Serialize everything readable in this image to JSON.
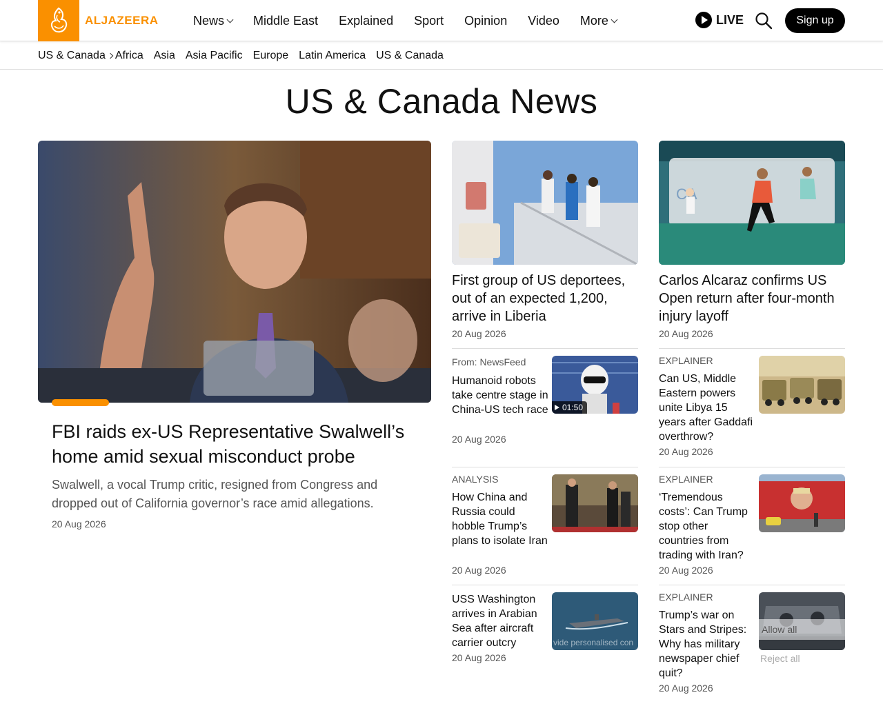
{
  "brand": {
    "name": "ALJAZEERA",
    "accent": "#fa9000"
  },
  "nav": {
    "items": [
      {
        "label": "News",
        "dropdown": true
      },
      {
        "label": "Middle East",
        "dropdown": false
      },
      {
        "label": "Explained",
        "dropdown": false
      },
      {
        "label": "Sport",
        "dropdown": false
      },
      {
        "label": "Opinion",
        "dropdown": false
      },
      {
        "label": "Video",
        "dropdown": false
      },
      {
        "label": "More",
        "dropdown": true
      }
    ],
    "live_label": "LIVE",
    "signup_label": "Sign up"
  },
  "subnav": {
    "current": "US & Canada",
    "items": [
      "Africa",
      "Asia",
      "Asia Pacific",
      "Europe",
      "Latin America",
      "US & Canada"
    ]
  },
  "page_title": "US & Canada News",
  "featured": {
    "title": "FBI raids ex-US Representative Swalwell’s home amid sexual misconduct probe",
    "summary": "Swalwell, a vocal Trump critic, resigned from Congress and dropped out of California governor’s race amid allegations.",
    "date": "20 Aug 2026"
  },
  "cards": [
    {
      "title": "First group of US deportees, out of an expected 1,200, arrive in Liberia",
      "date": "20 Aug 2026"
    },
    {
      "title": "Carlos Alcaraz confirms US Open return after four-month injury layoff",
      "date": "20 Aug 2026"
    }
  ],
  "col2": [
    {
      "label": "From: NewsFeed",
      "title": "Humanoid robots take centre stage in China-US tech race",
      "date": "20 Aug 2026",
      "video_duration": "01:50"
    },
    {
      "label": "ANALYSIS",
      "title": "How China and Russia could hobble Trump’s plans to isolate Iran",
      "date": "20 Aug 2026"
    },
    {
      "label": "",
      "title": "USS Washington arrives in Arabian Sea after aircraft carrier outcry",
      "date": "20 Aug 2026"
    }
  ],
  "col3": [
    {
      "label": "EXPLAINER",
      "title": "Can US, Middle Eastern powers unite Libya 15 years after Gaddafi overthrow?",
      "date": "20 Aug 2026"
    },
    {
      "label": "EXPLAINER",
      "title": "‘Tremendous costs’: Can Trump stop other countries from trading with Iran?",
      "date": "20 Aug 2026"
    },
    {
      "label": "EXPLAINER",
      "title": "Trump’s war on Stars and Stripes: Why has military newspaper chief quit?",
      "date": "20 Aug 2026"
    }
  ],
  "consent": {
    "text": "vide personalised con",
    "allow_label": "Allow all",
    "reject_label": "Reject all"
  }
}
